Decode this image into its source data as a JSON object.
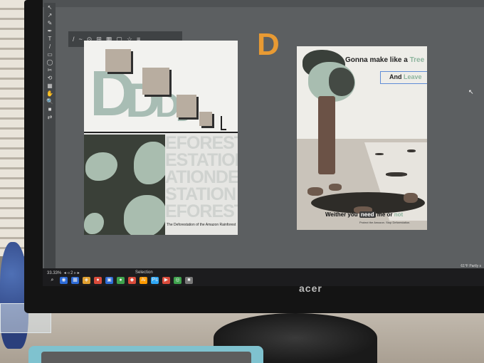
{
  "monitor": {
    "brand": "acer"
  },
  "tools": [
    "↖",
    "↗",
    "✎",
    "✒",
    "T",
    "/",
    "▭",
    "◯",
    "✂",
    "⟲",
    "▦",
    "✋",
    "🔍",
    "■",
    "⇄"
  ],
  "control_panel": {
    "items": [
      "/",
      "~",
      "⊙",
      "⊞",
      "▦",
      "▢",
      "☆",
      "≡"
    ]
  },
  "artboard_label": "D",
  "poster1": {
    "defo_lines": [
      "EFOREST",
      "ESTATION",
      "ATIONDE",
      "STATION",
      "EFOREST"
    ],
    "caption": "The Deforestation of the Amazon Rainforest"
  },
  "poster2": {
    "title_prefix": "Gonna make like a ",
    "title_highlight": "Tree",
    "sub_prefix": "And ",
    "sub_highlight": "Leave",
    "bottom_prefix": "Weither you ",
    "bottom_pill": "need",
    "bottom_mid": " me or ",
    "bottom_highlight": "not",
    "caption": "Protect the Amazon. Stop Deforestation."
  },
  "status_bar": {
    "zoom": "33.33%",
    "page": "2",
    "mode": "Selection"
  },
  "tray": {
    "weather": "61°F Partly s"
  },
  "taskbar_icons": [
    "⌕",
    "◉",
    "▦",
    "◈",
    "●",
    "▣",
    "●",
    "◆",
    "Ai",
    "Ps",
    "▶",
    "◎",
    "■"
  ],
  "colors": {
    "accent_orange": "#e89a33",
    "sage": "#8db59e",
    "selection_blue": "#5f8dd6"
  }
}
